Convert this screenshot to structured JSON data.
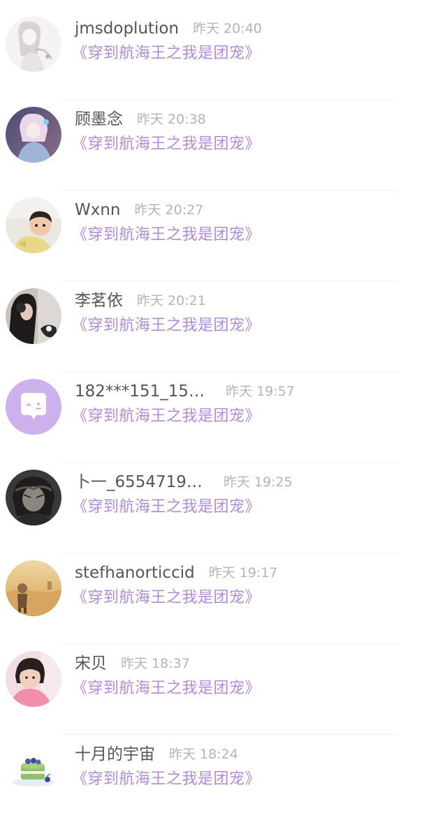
{
  "comments": [
    {
      "user": "jmsdoplution",
      "time": "昨天 20:40",
      "book": "《穿到航海王之我是团宠》",
      "avatar": "sketch-girl-avatar"
    },
    {
      "user": "顾墨念",
      "time": "昨天 20:38",
      "book": "《穿到航海王之我是团宠》",
      "avatar": "anime-girl-avatar"
    },
    {
      "user": "Wxnn",
      "time": "昨天 20:27",
      "book": "《穿到航海王之我是团宠》",
      "avatar": "baby-avatar"
    },
    {
      "user": "李茗依",
      "time": "昨天 20:21",
      "book": "《穿到航海王之我是团宠》",
      "avatar": "girl-headphones-avatar"
    },
    {
      "user": "182***151_15…",
      "time": "昨天 19:57",
      "book": "《穿到航海王之我是团宠》",
      "avatar": "default-chat-avatar"
    },
    {
      "user": "卜一_6554719…",
      "time": "昨天 19:25",
      "book": "《穿到航海王之我是团宠》",
      "avatar": "dark-anime-avatar"
    },
    {
      "user": "stefhanorticcid",
      "time": "昨天 19:17",
      "book": "《穿到航海王之我是团宠》",
      "avatar": "desert-astronaut-avatar"
    },
    {
      "user": "宋贝",
      "time": "昨天 18:37",
      "book": "《穿到航海王之我是团宠》",
      "avatar": "pink-child-avatar"
    },
    {
      "user": "十月的宇宙",
      "time": "昨天 18:24",
      "book": "《穿到航海王之我是团宠》",
      "avatar": "matcha-cake-avatar"
    }
  ],
  "colors": {
    "username": "#555555",
    "timestamp": "#b4b4b4",
    "book_title": "#b38ad8",
    "default_avatar_bg": "#cdb1ec"
  }
}
